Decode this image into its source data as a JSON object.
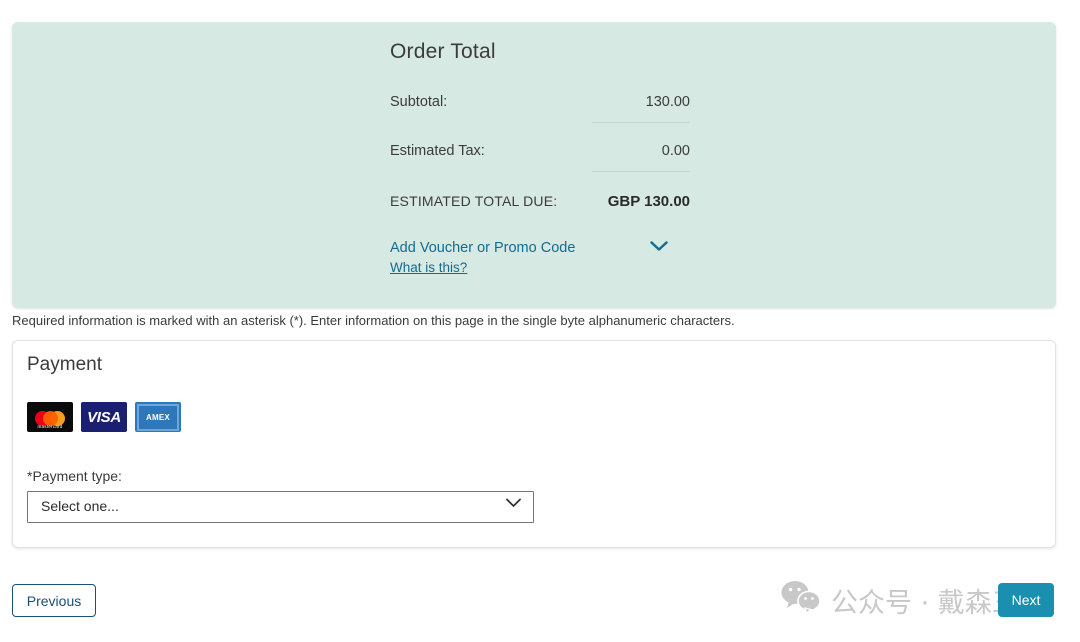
{
  "order_total": {
    "title": "Order Total",
    "rows": [
      {
        "label": "Subtotal:",
        "value": "130.00"
      },
      {
        "label": "Estimated Tax:",
        "value": "0.00"
      }
    ],
    "total": {
      "label": "ESTIMATED TOTAL DUE:",
      "value": "GBP 130.00"
    },
    "voucher_link": "Add Voucher or Promo Code",
    "voucher_chevron_icon": "chevron-down-icon",
    "what_is_this": "What is this?",
    "panel_color": "#d6e9e2",
    "link_color": "#146c8e"
  },
  "required_note": "Required information is marked with an asterisk (*). Enter information on this page in the single byte alphanumeric characters.",
  "payment": {
    "title": "Payment",
    "cards": [
      {
        "name": "mastercard-logo",
        "word": "mastercard",
        "bg": "#0a0a0a"
      },
      {
        "name": "visa-logo",
        "word": "VISA",
        "bg": "#1a1f71"
      },
      {
        "name": "amex-logo",
        "word": "AMEX",
        "bg": "#2e77bb"
      }
    ],
    "payment_type_label": "*Payment type:",
    "payment_type_value": "Select one...",
    "payment_type_chevron_icon": "chevron-down-icon"
  },
  "footer": {
    "previous_label": "Previous",
    "next_label": "Next",
    "next_color": "#1a8fb0",
    "previous_border_color": "#1a4f73"
  },
  "watermark": {
    "icon": "wechat-icon",
    "text": "公众号 · 戴森三"
  }
}
